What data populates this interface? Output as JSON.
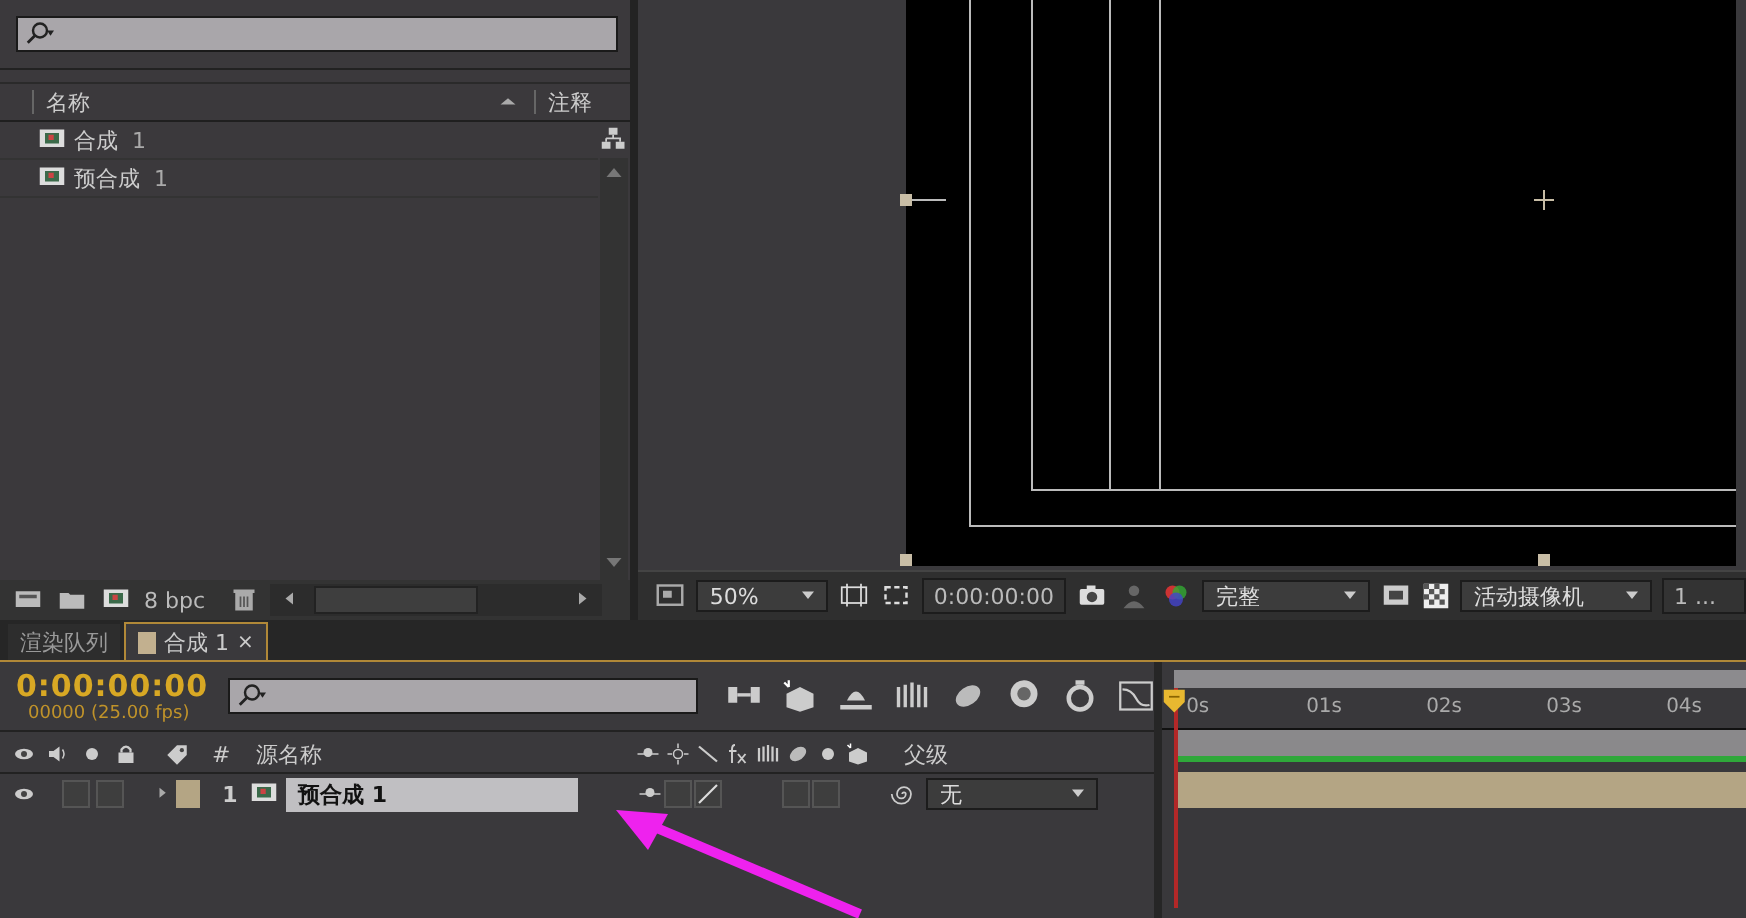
{
  "project": {
    "columns": [
      "名称",
      "注释"
    ],
    "items": [
      {
        "name": "合成",
        "number": "1"
      },
      {
        "name": "预合成",
        "number": "1"
      }
    ],
    "footer": {
      "depth": "8 bpc"
    }
  },
  "viewer": {
    "zoom": "50%",
    "timecode": "0:00:00:00",
    "resolution": "完整",
    "camera": "活动摄像机",
    "views": "1 ..."
  },
  "tabs": [
    {
      "label": "渲染队列",
      "selected": false
    },
    {
      "label": "合成 1",
      "selected": true,
      "close": "×"
    }
  ],
  "timeline": {
    "timecode": "0:00:00:00",
    "frame_info": "00000 (25.00 fps)",
    "columns": {
      "number": "#",
      "source_name": "源名称",
      "parent": "父级"
    },
    "ruler": [
      "0s",
      "01s",
      "02s",
      "03s",
      "04s"
    ],
    "layers": [
      {
        "number": "1",
        "name": "预合成 1",
        "selected": true,
        "visible": true,
        "parent": "无",
        "color": "#b4a584"
      }
    ]
  }
}
